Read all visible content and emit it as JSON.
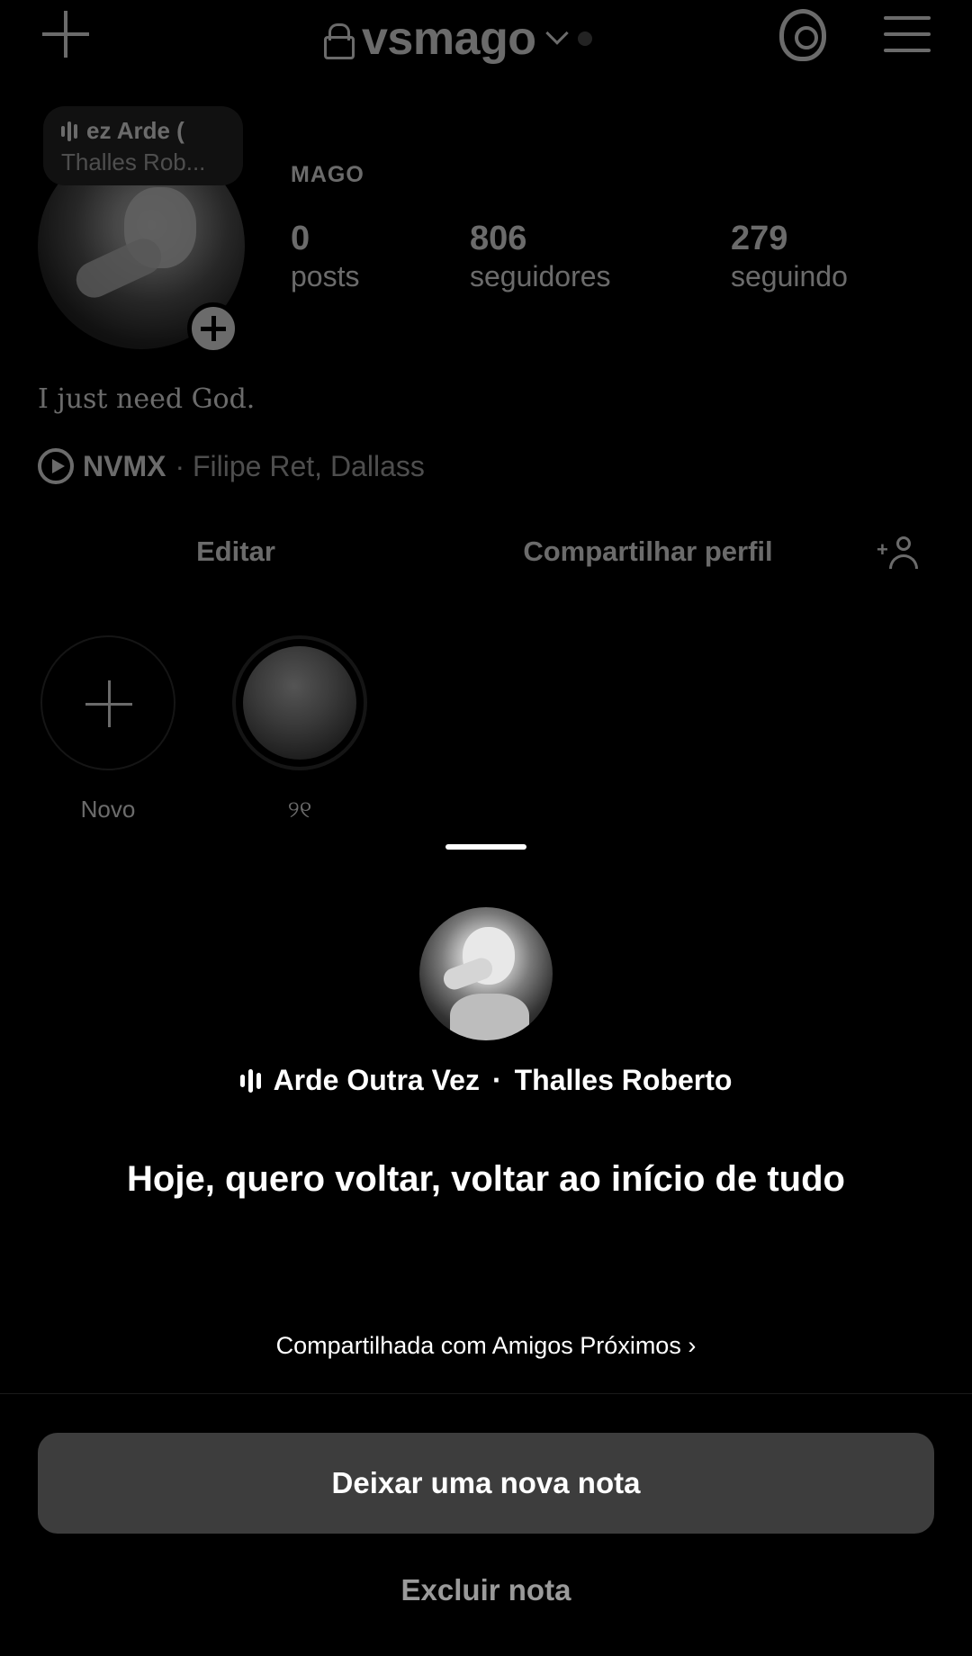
{
  "header": {
    "username": "vsmago",
    "create_icon": "plus-icon",
    "threads_icon": "threads-icon",
    "menu_icon": "hamburger-menu-icon"
  },
  "note_bubble": {
    "line1": "ez   Arde (",
    "line2": "Thalles Rob..."
  },
  "profile": {
    "name": "MAGO",
    "posts": {
      "value": "0",
      "label": "posts"
    },
    "followers": {
      "value": "806",
      "label": "seguidores"
    },
    "following": {
      "value": "279",
      "label": "seguindo"
    },
    "bio": "I just need God.",
    "music": {
      "song": "NVMX",
      "artists": "· Filipe Ret, Dallass"
    }
  },
  "actions": {
    "edit": "Editar",
    "share": "Compartilhar perfil"
  },
  "highlights": [
    {
      "label": "Novo"
    },
    {
      "label": "୨୧"
    }
  ],
  "sheet": {
    "song_title": "Arde Outra Vez",
    "song_separator": "·",
    "song_artist": "Thalles Roberto",
    "note": "Hoje, quero voltar, voltar ao início de tudo",
    "shared_with": "Compartilhada com Amigos Próximos ›",
    "primary_button": "Deixar uma nova nota",
    "delete_button": "Excluir nota"
  }
}
